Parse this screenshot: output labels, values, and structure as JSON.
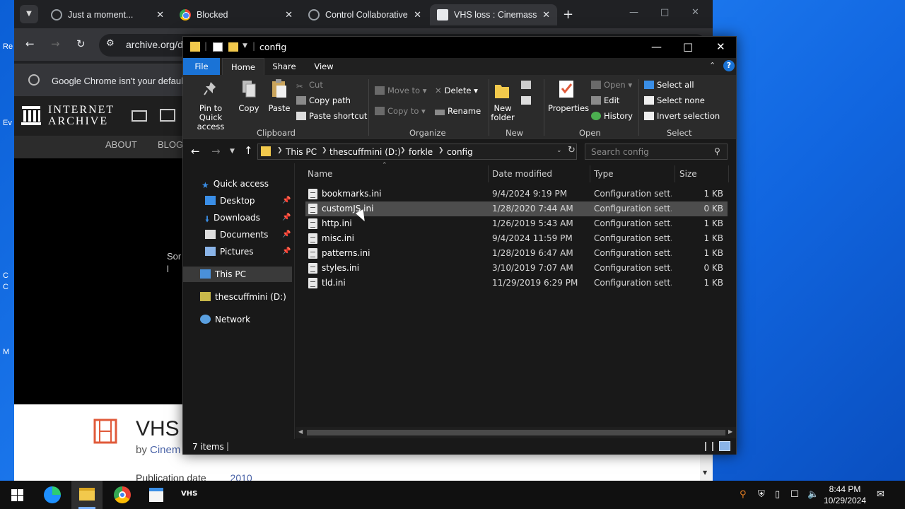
{
  "desktop": {
    "icon_labels": [
      "Re",
      "Ev",
      "C",
      "C",
      "M"
    ]
  },
  "chrome": {
    "tabs": [
      {
        "title": "Just a moment...",
        "favicon": "globe-icon"
      },
      {
        "title": "Blocked",
        "favicon": "chrome-icon"
      },
      {
        "title": "Control Collaborative",
        "favicon": "globe-icon"
      },
      {
        "title": "VHS loss : Cinemass",
        "favicon": "archive-icon"
      }
    ],
    "url": "archive.org/d",
    "infobar_text": "Google Chrome isn't your defaul",
    "ia_logo_line1": "INTERNET",
    "ia_logo_line2": "ARCHIVE",
    "ia_nav": [
      "ABOUT",
      "BLOG"
    ],
    "player_text": "Sor to l",
    "item_title": "VHS",
    "item_by_prefix": "by",
    "item_by_link": "Cinem",
    "pub_label": "Publication date",
    "pub_value": "2010"
  },
  "explorer": {
    "title": "config",
    "ribbon_tabs": [
      "File",
      "Home",
      "Share",
      "View"
    ],
    "ribbon": {
      "clipboard": {
        "label": "Clipboard",
        "pin": "Pin to Quick access",
        "copy": "Copy",
        "paste": "Paste",
        "cut": "Cut",
        "copy_path": "Copy path",
        "paste_shortcut": "Paste shortcut"
      },
      "organize": {
        "label": "Organize",
        "move_to": "Move to",
        "copy_to": "Copy to",
        "delete": "Delete",
        "rename": "Rename"
      },
      "new": {
        "label": "New",
        "new_folder": "New folder"
      },
      "open": {
        "label": "Open",
        "properties": "Properties",
        "open": "Open",
        "edit": "Edit",
        "history": "History"
      },
      "select": {
        "label": "Select",
        "select_all": "Select all",
        "select_none": "Select none",
        "invert": "Invert selection"
      }
    },
    "breadcrumb": [
      "This PC",
      "thescuffmini (D:)",
      "forkle",
      "config"
    ],
    "search_placeholder": "Search config",
    "nav": {
      "quick_access": "Quick access",
      "desktop": "Desktop",
      "downloads": "Downloads",
      "documents": "Documents",
      "pictures": "Pictures",
      "this_pc": "This PC",
      "drive": "thescuffmini (D:)",
      "network": "Network"
    },
    "columns": {
      "name": "Name",
      "date": "Date modified",
      "type": "Type",
      "size": "Size"
    },
    "files": [
      {
        "name": "bookmarks.ini",
        "date": "9/4/2024 9:19 PM",
        "type": "Configuration sett...",
        "size": "1 KB"
      },
      {
        "name": "customJS.ini",
        "date": "1/28/2020 7:44 AM",
        "type": "Configuration sett...",
        "size": "0 KB"
      },
      {
        "name": "http.ini",
        "date": "1/26/2019 5:43 AM",
        "type": "Configuration sett...",
        "size": "1 KB"
      },
      {
        "name": "misc.ini",
        "date": "9/4/2024 11:59 PM",
        "type": "Configuration sett...",
        "size": "1 KB"
      },
      {
        "name": "patterns.ini",
        "date": "1/28/2019 6:47 AM",
        "type": "Configuration sett...",
        "size": "1 KB"
      },
      {
        "name": "styles.ini",
        "date": "3/10/2019 7:07 AM",
        "type": "Configuration sett...",
        "size": "0 KB"
      },
      {
        "name": "tld.ini",
        "date": "11/29/2019 6:29 PM",
        "type": "Configuration sett...",
        "size": "1 KB"
      }
    ],
    "status": "7 items"
  },
  "taskbar": {
    "vhs_label": "VHS",
    "time": "8:44 PM",
    "date": "10/29/2024"
  },
  "colors": {
    "accent": "#1a73d6",
    "desktop": "#0b5fd6"
  }
}
